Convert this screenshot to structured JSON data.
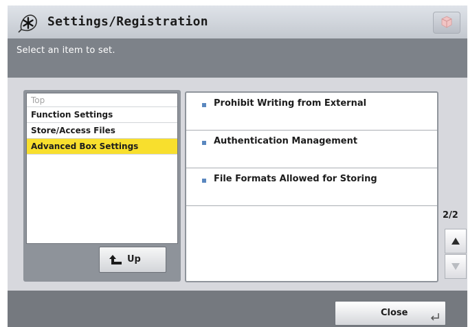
{
  "header": {
    "title": "Settings/Registration"
  },
  "message": {
    "text": "Select an item to set."
  },
  "tree": {
    "items": [
      {
        "label": "Top"
      },
      {
        "label": "Function Settings"
      },
      {
        "label": "Store/Access Files"
      },
      {
        "label": "Advanced Box Settings"
      }
    ],
    "up_label": "Up"
  },
  "list": {
    "items": [
      {
        "label": "Prohibit Writing from External"
      },
      {
        "label": "Authentication Management"
      },
      {
        "label": "File Formats Allowed for Storing"
      }
    ]
  },
  "pager": {
    "text": "2/2"
  },
  "footer": {
    "close_label": "Close"
  },
  "colors": {
    "selected": "#f8df2d",
    "bullet": "#5a87bf",
    "message_bar": "#7d8289",
    "footer_bar": "#75797f"
  },
  "icons": {
    "app": "settings-asterisk-icon",
    "corner": "cube-icon",
    "up": "up-arrow-icon",
    "scroll_up": "triangle-up-icon",
    "scroll_down": "triangle-down-icon",
    "close": "enter-return-icon"
  }
}
